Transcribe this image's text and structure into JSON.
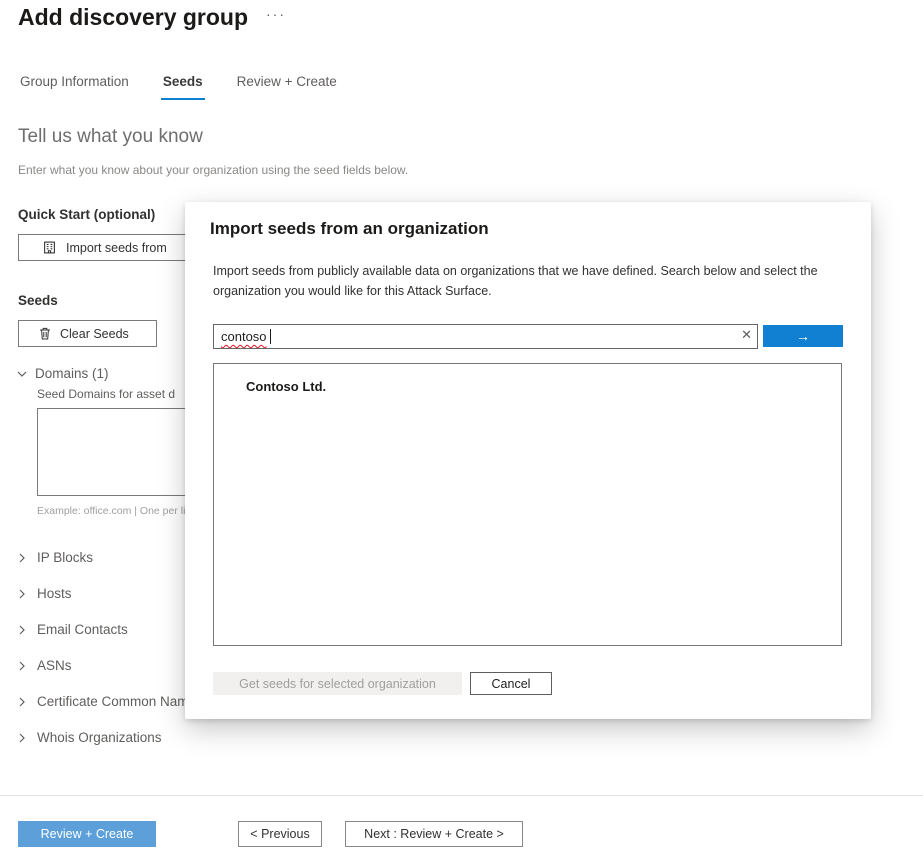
{
  "header": {
    "title": "Add discovery group"
  },
  "icons": {
    "ellipsis": "···",
    "clear": "✕",
    "arrow_right": "→"
  },
  "tabs": [
    {
      "label": "Group Information",
      "active": false
    },
    {
      "label": "Seeds",
      "active": true
    },
    {
      "label": "Review + Create",
      "active": false
    }
  ],
  "seeds_form": {
    "heading": "Tell us what you know",
    "subheading": "Enter what you know about your organization using the seed fields below.",
    "quick_start_label": "Quick Start (optional)",
    "import_button_label": "Import seeds from",
    "seeds_label": "Seeds",
    "clear_seeds_label": "Clear Seeds",
    "domains": {
      "label": "Domains (1)",
      "field_label": "Seed Domains for asset d",
      "value": "",
      "example": "Example: office.com | One per line"
    },
    "sections": [
      "IP Blocks",
      "Hosts",
      "Email Contacts",
      "ASNs",
      "Certificate Common Name",
      "Whois Organizations"
    ]
  },
  "footer": {
    "review_create_label": "Review + Create",
    "previous_label": "< Previous",
    "next_label": "Next : Review + Create >"
  },
  "dialog": {
    "title": "Import seeds from an organization",
    "description": "Import seeds from publicly available data on organizations that we have defined. Search below and select the organization you would like for this Attack Surface.",
    "search": {
      "value": "contoso"
    },
    "results": [
      "Contoso Ltd."
    ],
    "get_seeds_label": "Get seeds for selected organization",
    "cancel_label": "Cancel"
  },
  "colors": {
    "accent": "#1180d2",
    "primary_footer_button": "#5c9fd9",
    "tab_underline": "#0f7fd3",
    "error_underline": "#e81123"
  }
}
